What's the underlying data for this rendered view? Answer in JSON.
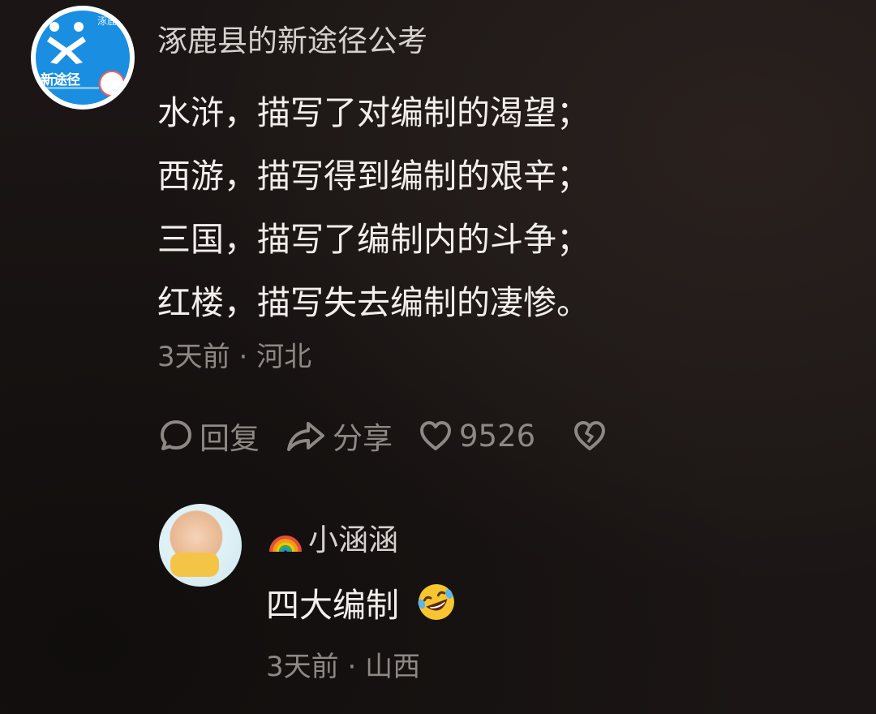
{
  "comment": {
    "author": "涿鹿县的新途径公考",
    "avatar": {
      "brand_text": "新途径",
      "corner_tag": "涿鹿径"
    },
    "lines": [
      "水浒，描写了对编制的渴望；",
      "西游，描写得到编制的艰辛；",
      "三国，描写了编制内的斗争；",
      "红楼，描写失去编制的凄惨。"
    ],
    "time": "3天前",
    "separator": "·",
    "location": "河北",
    "actions": {
      "reply_label": "回复",
      "share_label": "分享",
      "like_count": "9526"
    }
  },
  "reply": {
    "author": "小涵涵",
    "author_icon": "rainbow-icon",
    "text": "四大编制",
    "emoji": "rofl-emoji-icon",
    "time": "3天前",
    "separator": "·",
    "location": "山西"
  },
  "colors": {
    "background": "#1b1615",
    "primary_text": "#f2eeec",
    "secondary_text": "#8e8884",
    "avatar_blue": "#1a8ee0"
  }
}
